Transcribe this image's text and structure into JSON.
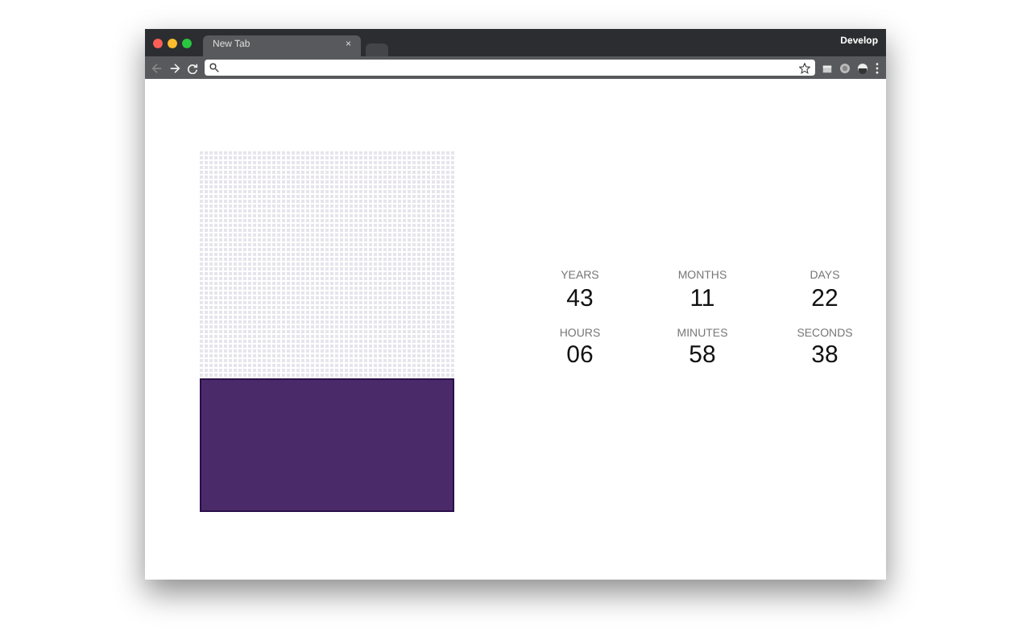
{
  "browser": {
    "tabs": [
      {
        "label": "New Tab",
        "close": "×",
        "selected": true
      },
      {
        "selected": false
      }
    ],
    "profile": "Develop"
  },
  "life_meter": {
    "level": 0.37
  },
  "countdown": [
    {
      "unit": "YEARS",
      "value": "43"
    },
    {
      "unit": "MONTHS",
      "value": "11"
    },
    {
      "unit": "DAYS",
      "value": "22"
    },
    {
      "unit": "HOURS",
      "value": "06"
    },
    {
      "unit": "MINUTES",
      "value": "58"
    },
    {
      "unit": "SECONDS",
      "value": "38"
    }
  ]
}
